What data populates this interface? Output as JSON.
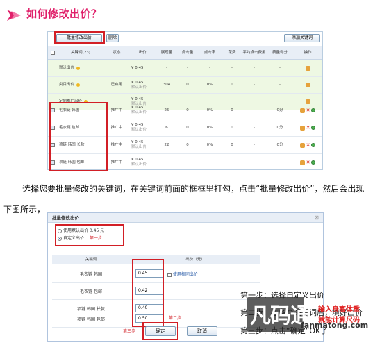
{
  "title": "如何修改出价？",
  "panel1": {
    "toolbar": {
      "batch_modify": "批量修改出价",
      "delete": "删除",
      "add_keyword": "添加关键词"
    },
    "headers": [
      "关键词(23)",
      "状态",
      "出价",
      "展现量",
      "点击量",
      "点击率",
      "花费",
      "平均点击费用",
      "质量得分",
      "操作"
    ],
    "default_rows": [
      {
        "keyword": "默认出价",
        "status": "",
        "bid": "¥ 0.45",
        "bid_note": "",
        "impressions": "-",
        "clicks": "-",
        "ctr": "-",
        "cost": "-",
        "avg_cpc": "-",
        "quality": "-"
      },
      {
        "keyword": "类目出价",
        "status": "已启用",
        "bid": "¥ 0.45",
        "bid_note": "默认出价",
        "impressions": "304",
        "clicks": "0",
        "ctr": "0%",
        "cost": "0",
        "avg_cpc": "-",
        "quality": "-"
      },
      {
        "keyword": "定向推广出价",
        "status": "",
        "bid": "¥ 0.45",
        "bid_note": "默认出价",
        "impressions": "-",
        "clicks": "-",
        "ctr": "-",
        "cost": "-",
        "avg_cpc": "-",
        "quality": "-"
      }
    ],
    "keyword_rows": [
      {
        "keyword": "毛衣链 韩国",
        "status": "推广中",
        "bid": "¥ 0.45",
        "bid_note": "默认出价",
        "impressions": "25",
        "clicks": "0",
        "ctr": "0%",
        "cost": "0",
        "avg_cpc": "-",
        "quality": "0分",
        "checked": true
      },
      {
        "keyword": "毛衣链 包邮",
        "status": "推广中",
        "bid": "¥ 0.45",
        "bid_note": "默认出价",
        "impressions": "6",
        "clicks": "0",
        "ctr": "0%",
        "cost": "0",
        "avg_cpc": "-",
        "quality": "0分",
        "checked": true
      },
      {
        "keyword": "项链 韩国 长款",
        "status": "推广中",
        "bid": "¥ 0.45",
        "bid_note": "默认出价",
        "impressions": "22",
        "clicks": "0",
        "ctr": "0%",
        "cost": "0",
        "avg_cpc": "-",
        "quality": "0分",
        "checked": true
      },
      {
        "keyword": "项链 韩国 包邮",
        "status": "推广中",
        "bid": "¥ 0.45",
        "bid_note": "默认出价",
        "impressions": "-",
        "clicks": "-",
        "ctr": "-",
        "cost": "-",
        "avg_cpc": "-",
        "quality": "-",
        "checked": true
      }
    ]
  },
  "description": {
    "line1": "选择您要批量修改的关键词，在关键词前面的框框里打勾，点击“批量修改出价”，然后会出现",
    "line2": "下图所示，"
  },
  "dialog": {
    "title": "批量修改出价",
    "close": "⊠",
    "option_default": "使用默认出价 0.45 元",
    "option_custom": "自定义出价",
    "step1_label": "第一步",
    "col_keyword": "关键词",
    "col_bid": "出价（元）",
    "use_same_bid": "使用相同出价",
    "rows": [
      {
        "keyword": "毛衣链 韩国",
        "value": "0.45"
      },
      {
        "keyword": "毛衣链 包邮",
        "value": "0.42"
      },
      {
        "keyword": "项链 韩国 长款",
        "value": "0.40"
      },
      {
        "keyword": "项链 韩国 包邮",
        "value": "0.50"
      }
    ],
    "step2_label": "第二步",
    "step3_label": "第三步",
    "confirm": "确定",
    "cancel": "取消"
  },
  "steps": {
    "step1": "第一步：选择自定义出价",
    "step2": "第二步：在各个关键词后，填好出价",
    "step3": "第三步：点击“确定”OK了"
  },
  "watermark": {
    "brand": "凡码通",
    "url": "fanmatong.com"
  },
  "promo": {
    "line1": "输入身高体重",
    "line2": "就能计算尺码"
  },
  "colors": {
    "title": "#e0206a",
    "highlight_box": "#d21f26",
    "header_bg": "#e8eef6",
    "default_row_bg": "#eef8e3"
  }
}
